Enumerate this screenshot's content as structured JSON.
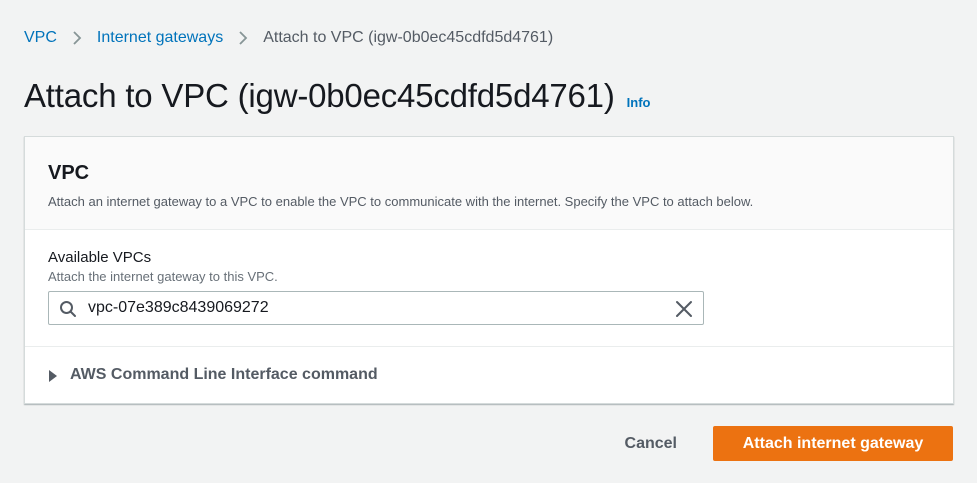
{
  "breadcrumb": {
    "items": [
      {
        "label": "VPC"
      },
      {
        "label": "Internet gateways"
      }
    ],
    "current": "Attach to VPC (igw-0b0ec45cdfd5d4761)"
  },
  "page": {
    "title": "Attach to VPC (igw-0b0ec45cdfd5d4761)",
    "info_label": "Info"
  },
  "vpc_panel": {
    "title": "VPC",
    "description": "Attach an internet gateway to a VPC to enable the VPC to communicate with the internet. Specify the VPC to attach below.",
    "field": {
      "label": "Available VPCs",
      "description": "Attach the internet gateway to this VPC.",
      "value": "vpc-07e389c8439069272"
    },
    "cli_expander_label": "AWS Command Line Interface command"
  },
  "actions": {
    "cancel_label": "Cancel",
    "submit_label": "Attach internet gateway"
  },
  "icons": {
    "search": "search-icon",
    "clear": "close-icon",
    "separator": "chevron-right-icon",
    "expander": "caret-right-icon"
  },
  "colors": {
    "link": "#0073bb",
    "primary_button": "#ec7211",
    "background": "#f2f3f3"
  }
}
